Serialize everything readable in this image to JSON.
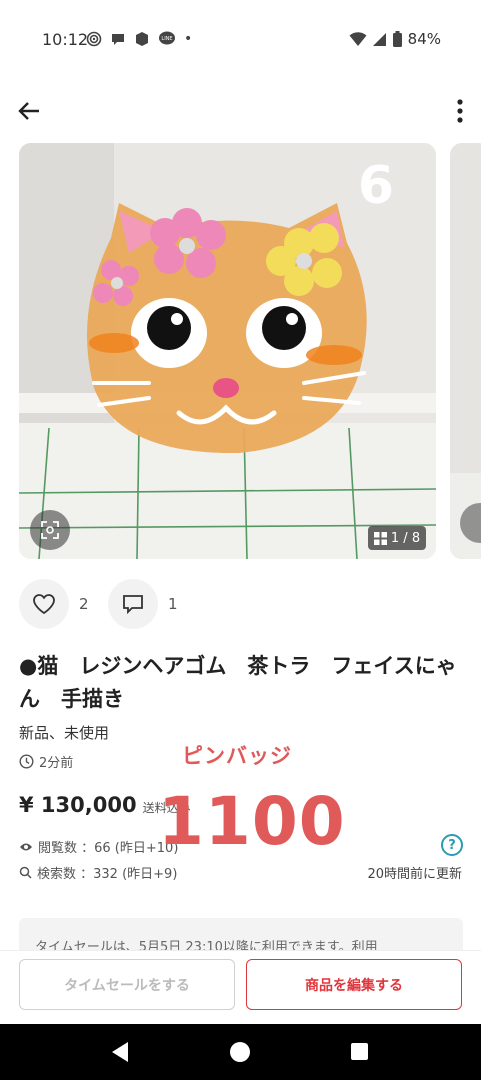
{
  "status_bar": {
    "time": "10:12",
    "notification_icons": [
      "podcast-icon",
      "chat-bubble-icon",
      "cube-icon",
      "line-icon"
    ],
    "dot": "•",
    "battery": "84%"
  },
  "gallery": {
    "photo_number": "6",
    "counter": "1 / 8",
    "colors": {
      "background": "#eceae6",
      "cat": "#e9a95a",
      "pink_flower": "#ee88b8",
      "yellow_flower": "#f2dc5a",
      "grid": "#3a8a4a"
    }
  },
  "actions": {
    "likes_count": "2",
    "comments_count": "1"
  },
  "item": {
    "title": "●猫　レジンヘアゴム　茶トラ　フェイスにゃん　手描き",
    "condition": "新品、未使用",
    "posted": "2分前",
    "price": "¥ 130,000",
    "shipping": "送料込み",
    "views": "閲覧数 ：66 (昨日+10)",
    "searches": "検索数 ：332 (昨日+9)",
    "updated": "20時間前に更新",
    "help": "?"
  },
  "overlay": {
    "subtitle": "ピンバッジ",
    "big_price": "1100",
    "color": "#e05a5a"
  },
  "notice": "タイムセールは、5月5日 23:10以降に利用できます。利用",
  "buttons": {
    "time_sale": "タイムセールをする",
    "edit": "商品を編集する"
  },
  "accent_color": "#e0363e"
}
